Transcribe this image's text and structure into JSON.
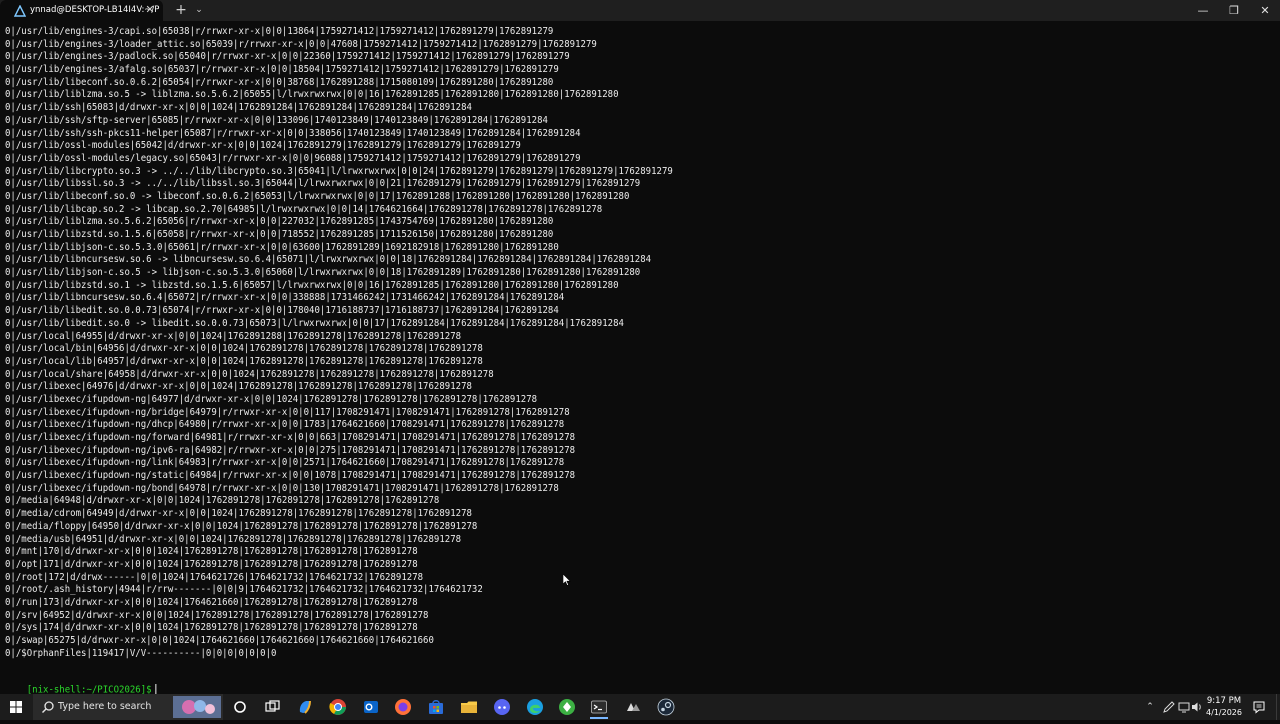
{
  "window": {
    "tab_title": "ynnad@DESKTOP-LB14I4V:~/P",
    "tab_icon": "terminal-app-icon",
    "close_glyph": "✕",
    "new_tab_glyph": "+",
    "dropdown_glyph": "⌄",
    "minimize_glyph": "—",
    "maximize_glyph": "❐",
    "win_close_glyph": "✕"
  },
  "terminal": {
    "lines": [
      "0|/usr/lib/engines-3/capi.so|65038|r/rrwxr-xr-x|0|0|13864|1759271412|1759271412|1762891279|1762891279",
      "0|/usr/lib/engines-3/loader_attic.so|65039|r/rrwxr-xr-x|0|0|47608|1759271412|1759271412|1762891279|1762891279",
      "0|/usr/lib/engines-3/padlock.so|65040|r/rrwxr-xr-x|0|0|22360|1759271412|1759271412|1762891279|1762891279",
      "0|/usr/lib/engines-3/afalg.so|65037|r/rrwxr-xr-x|0|0|18504|1759271412|1759271412|1762891279|1762891279",
      "0|/usr/lib/libeconf.so.0.6.2|65054|r/rrwxr-xr-x|0|0|38768|1762891288|1715080109|1762891280|1762891280",
      "0|/usr/lib/liblzma.so.5 -> liblzma.so.5.6.2|65055|l/lrwxrwxrwx|0|0|16|1762891285|1762891280|1762891280|1762891280",
      "0|/usr/lib/ssh|65083|d/drwxr-xr-x|0|0|1024|1762891284|1762891284|1762891284|1762891284",
      "0|/usr/lib/ssh/sftp-server|65085|r/rrwxr-xr-x|0|0|133096|1740123849|1740123849|1762891284|1762891284",
      "0|/usr/lib/ssh/ssh-pkcs11-helper|65087|r/rrwxr-xr-x|0|0|338056|1740123849|1740123849|1762891284|1762891284",
      "0|/usr/lib/ossl-modules|65042|d/drwxr-xr-x|0|0|1024|1762891279|1762891279|1762891279|1762891279",
      "0|/usr/lib/ossl-modules/legacy.so|65043|r/rrwxr-xr-x|0|0|96088|1759271412|1759271412|1762891279|1762891279",
      "0|/usr/lib/libcrypto.so.3 -> ../../lib/libcrypto.so.3|65041|l/lrwxrwxrwx|0|0|24|1762891279|1762891279|1762891279|1762891279",
      "0|/usr/lib/libssl.so.3 -> ../../lib/libssl.so.3|65044|l/lrwxrwxrwx|0|0|21|1762891279|1762891279|1762891279|1762891279",
      "0|/usr/lib/libeconf.so.0 -> libeconf.so.0.6.2|65053|l/lrwxrwxrwx|0|0|17|1762891288|1762891280|1762891280|1762891280",
      "0|/usr/lib/libcap.so.2 -> libcap.so.2.70|64985|l/lrwxrwxrwx|0|0|14|1764621664|1762891278|1762891278|1762891278",
      "0|/usr/lib/liblzma.so.5.6.2|65056|r/rrwxr-xr-x|0|0|227032|1762891285|1743754769|1762891280|1762891280",
      "0|/usr/lib/libzstd.so.1.5.6|65058|r/rrwxr-xr-x|0|0|718552|1762891285|1711526150|1762891280|1762891280",
      "0|/usr/lib/libjson-c.so.5.3.0|65061|r/rrwxr-xr-x|0|0|63600|1762891289|1692182918|1762891280|1762891280",
      "0|/usr/lib/libncursesw.so.6 -> libncursesw.so.6.4|65071|l/lrwxrwxrwx|0|0|18|1762891284|1762891284|1762891284|1762891284",
      "0|/usr/lib/libjson-c.so.5 -> libjson-c.so.5.3.0|65060|l/lrwxrwxrwx|0|0|18|1762891289|1762891280|1762891280|1762891280",
      "0|/usr/lib/libzstd.so.1 -> libzstd.so.1.5.6|65057|l/lrwxrwxrwx|0|0|16|1762891285|1762891280|1762891280|1762891280",
      "0|/usr/lib/libncursesw.so.6.4|65072|r/rrwxr-xr-x|0|0|338888|1731466242|1731466242|1762891284|1762891284",
      "0|/usr/lib/libedit.so.0.0.73|65074|r/rrwxr-xr-x|0|0|178040|1716188737|1716188737|1762891284|1762891284",
      "0|/usr/lib/libedit.so.0 -> libedit.so.0.0.73|65073|l/lrwxrwxrwx|0|0|17|1762891284|1762891284|1762891284|1762891284",
      "0|/usr/local|64955|d/drwxr-xr-x|0|0|1024|1762891288|1762891278|1762891278|1762891278",
      "0|/usr/local/bin|64956|d/drwxr-xr-x|0|0|1024|1762891278|1762891278|1762891278|1762891278",
      "0|/usr/local/lib|64957|d/drwxr-xr-x|0|0|1024|1762891278|1762891278|1762891278|1762891278",
      "0|/usr/local/share|64958|d/drwxr-xr-x|0|0|1024|1762891278|1762891278|1762891278|1762891278",
      "0|/usr/libexec|64976|d/drwxr-xr-x|0|0|1024|1762891278|1762891278|1762891278|1762891278",
      "0|/usr/libexec/ifupdown-ng|64977|d/drwxr-xr-x|0|0|1024|1762891278|1762891278|1762891278|1762891278",
      "0|/usr/libexec/ifupdown-ng/bridge|64979|r/rrwxr-xr-x|0|0|117|1708291471|1708291471|1762891278|1762891278",
      "0|/usr/libexec/ifupdown-ng/dhcp|64980|r/rrwxr-xr-x|0|0|1783|1764621660|1708291471|1762891278|1762891278",
      "0|/usr/libexec/ifupdown-ng/forward|64981|r/rrwxr-xr-x|0|0|663|1708291471|1708291471|1762891278|1762891278",
      "0|/usr/libexec/ifupdown-ng/ipv6-ra|64982|r/rrwxr-xr-x|0|0|275|1708291471|1708291471|1762891278|1762891278",
      "0|/usr/libexec/ifupdown-ng/link|64983|r/rrwxr-xr-x|0|0|2571|1764621660|1708291471|1762891278|1762891278",
      "0|/usr/libexec/ifupdown-ng/static|64984|r/rrwxr-xr-x|0|0|1078|1708291471|1708291471|1762891278|1762891278",
      "0|/usr/libexec/ifupdown-ng/bond|64978|r/rrwxr-xr-x|0|0|130|1708291471|1708291471|1762891278|1762891278",
      "0|/media|64948|d/drwxr-xr-x|0|0|1024|1762891278|1762891278|1762891278|1762891278",
      "0|/media/cdrom|64949|d/drwxr-xr-x|0|0|1024|1762891278|1762891278|1762891278|1762891278",
      "0|/media/floppy|64950|d/drwxr-xr-x|0|0|1024|1762891278|1762891278|1762891278|1762891278",
      "0|/media/usb|64951|d/drwxr-xr-x|0|0|1024|1762891278|1762891278|1762891278|1762891278",
      "0|/mnt|170|d/drwxr-xr-x|0|0|1024|1762891278|1762891278|1762891278|1762891278",
      "0|/opt|171|d/drwxr-xr-x|0|0|1024|1762891278|1762891278|1762891278|1762891278",
      "0|/root|172|d/drwx------|0|0|1024|1764621726|1764621732|1764621732|1762891278",
      "0|/root/.ash_history|4944|r/rrw-------|0|0|9|1764621732|1764621732|1764621732|1764621732",
      "0|/run|173|d/drwxr-xr-x|0|0|1024|1764621660|1762891278|1762891278|1762891278",
      "0|/srv|64952|d/drwxr-xr-x|0|0|1024|1762891278|1762891278|1762891278|1762891278",
      "0|/sys|174|d/drwxr-xr-x|0|0|1024|1762891278|1762891278|1762891278|1762891278",
      "0|/swap|65275|d/drwxr-xr-x|0|0|1024|1764621660|1764621660|1764621660|1764621660",
      "0|/$OrphanFiles|119417|V/V----------|0|0|0|0|0|0|0"
    ],
    "prompt": "[nix-shell:~/PICO2026]$"
  },
  "taskbar": {
    "search_placeholder": "Type here to search",
    "apps": [
      "cortana-icon",
      "task-view-icon",
      "copilot-icon",
      "chrome-icon",
      "outlook-icon",
      "firefox-icon",
      "store-icon",
      "file-explorer-icon",
      "discord-icon",
      "edge-icon",
      "vpn-icon",
      "terminal-icon",
      "wsl-icon",
      "steam-icon"
    ],
    "clock_time": "9:17 PM",
    "clock_date": "4/1/2026",
    "accent": "#7ab7ff"
  },
  "colors": {
    "terminal_bg": "#0c0c0c",
    "terminal_fg": "#ececec",
    "prompt": "#2bd82b"
  }
}
